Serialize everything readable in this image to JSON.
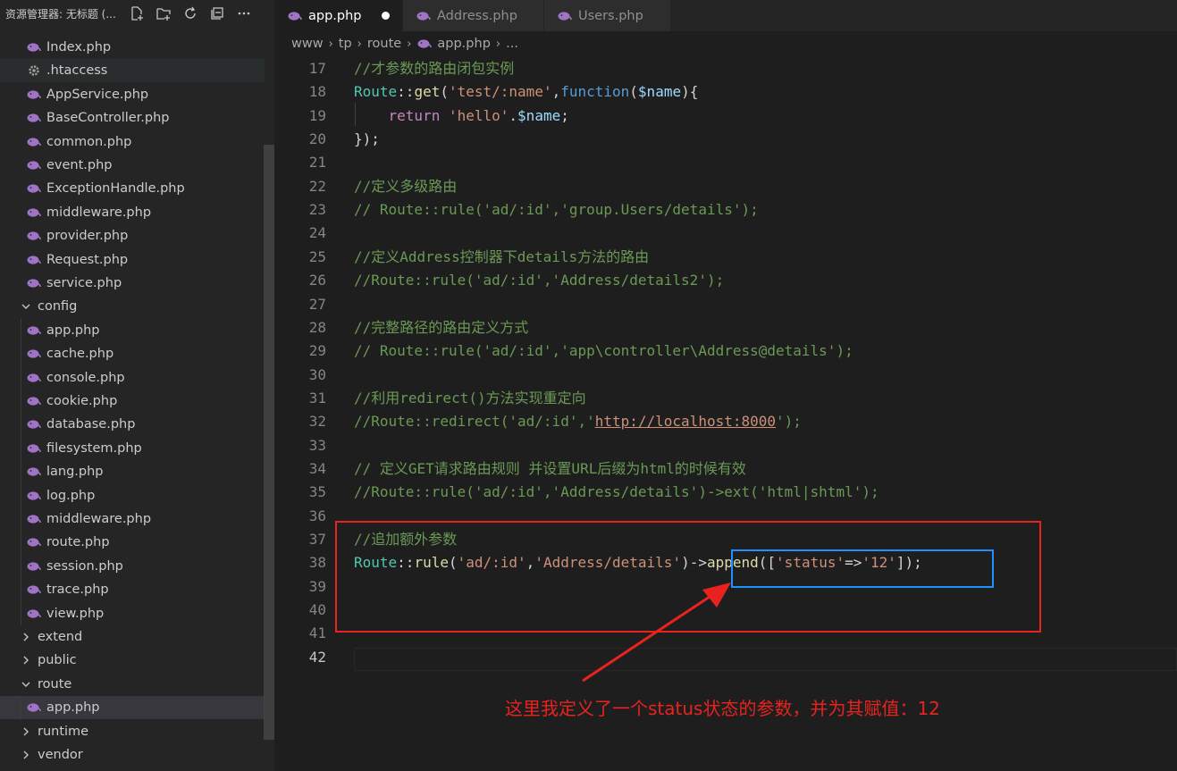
{
  "sidebar": {
    "title": "资源管理器: 无标题 (...",
    "tree": [
      {
        "label": "Index.php",
        "kind": "php"
      },
      {
        "label": ".htaccess",
        "kind": "gear"
      },
      {
        "label": "AppService.php",
        "kind": "php"
      },
      {
        "label": "BaseController.php",
        "kind": "php"
      },
      {
        "label": "common.php",
        "kind": "php"
      },
      {
        "label": "event.php",
        "kind": "php"
      },
      {
        "label": "ExceptionHandle.php",
        "kind": "php"
      },
      {
        "label": "middleware.php",
        "kind": "php"
      },
      {
        "label": "provider.php",
        "kind": "php"
      },
      {
        "label": "Request.php",
        "kind": "php"
      },
      {
        "label": "service.php",
        "kind": "php"
      },
      {
        "label": "config",
        "kind": "folder-open"
      },
      {
        "label": "app.php",
        "kind": "php"
      },
      {
        "label": "cache.php",
        "kind": "php"
      },
      {
        "label": "console.php",
        "kind": "php"
      },
      {
        "label": "cookie.php",
        "kind": "php"
      },
      {
        "label": "database.php",
        "kind": "php"
      },
      {
        "label": "filesystem.php",
        "kind": "php"
      },
      {
        "label": "lang.php",
        "kind": "php"
      },
      {
        "label": "log.php",
        "kind": "php"
      },
      {
        "label": "middleware.php",
        "kind": "php"
      },
      {
        "label": "route.php",
        "kind": "php"
      },
      {
        "label": "session.php",
        "kind": "php"
      },
      {
        "label": "trace.php",
        "kind": "php"
      },
      {
        "label": "view.php",
        "kind": "php"
      },
      {
        "label": "extend",
        "kind": "folder-closed"
      },
      {
        "label": "public",
        "kind": "folder-closed"
      },
      {
        "label": "route",
        "kind": "folder-open"
      },
      {
        "label": "app.php",
        "kind": "php"
      },
      {
        "label": "runtime",
        "kind": "folder-closed"
      },
      {
        "label": "vendor",
        "kind": "folder-closed"
      }
    ]
  },
  "tabs": [
    {
      "label": "app.php",
      "active": true,
      "dirty": true
    },
    {
      "label": "Address.php",
      "active": false,
      "dirty": false
    },
    {
      "label": "Users.php",
      "active": false,
      "dirty": false
    }
  ],
  "breadcrumb": [
    "www",
    "tp",
    "route",
    "app.php",
    "..."
  ],
  "editor": {
    "active_line": "42",
    "lines": [
      {
        "n": "17",
        "tokens": [
          [
            "c-cmt",
            "//才参数的路由闭包实例"
          ]
        ]
      },
      {
        "n": "18",
        "tokens": [
          [
            "c-cls",
            "Route"
          ],
          [
            "",
            "::"
          ],
          [
            "c-fn",
            "get"
          ],
          [
            "",
            "("
          ],
          [
            "c-str",
            "'test/:name'"
          ],
          [
            "",
            ","
          ],
          [
            "c-sto",
            "function"
          ],
          [
            "",
            "("
          ],
          [
            "c-var",
            "$name"
          ],
          [
            "",
            "){"
          ]
        ]
      },
      {
        "n": "19",
        "tokens": [
          [
            "",
            "    "
          ],
          [
            "c-kw",
            "return"
          ],
          [
            "",
            " "
          ],
          [
            "c-str",
            "'hello'"
          ],
          [
            "",
            "."
          ],
          [
            "c-var",
            "$name"
          ],
          [
            "",
            ";"
          ]
        ]
      },
      {
        "n": "20",
        "tokens": [
          [
            "",
            "});"
          ]
        ]
      },
      {
        "n": "21",
        "tokens": []
      },
      {
        "n": "22",
        "tokens": [
          [
            "c-cmt",
            "//定义多级路由"
          ]
        ]
      },
      {
        "n": "23",
        "tokens": [
          [
            "c-cmt",
            "// Route::rule('ad/:id','group.Users/details');"
          ]
        ]
      },
      {
        "n": "24",
        "tokens": []
      },
      {
        "n": "25",
        "tokens": [
          [
            "c-cmt",
            "//定义Address控制器下details方法的路由"
          ]
        ]
      },
      {
        "n": "26",
        "tokens": [
          [
            "c-cmt",
            "//Route::rule('ad/:id','Address/details2');"
          ]
        ]
      },
      {
        "n": "27",
        "tokens": []
      },
      {
        "n": "28",
        "tokens": [
          [
            "c-cmt",
            "//完整路径的路由定义方式"
          ]
        ]
      },
      {
        "n": "29",
        "tokens": [
          [
            "c-cmt",
            "// Route::rule('ad/:id','app\\controller\\Address@details');"
          ]
        ]
      },
      {
        "n": "30",
        "tokens": []
      },
      {
        "n": "31",
        "tokens": [
          [
            "c-cmt",
            "//利用redirect()方法实现重定向"
          ]
        ]
      },
      {
        "n": "32",
        "tokens": [
          [
            "c-cmt",
            "//Route::redirect('ad/:id','"
          ],
          [
            "c-url",
            "http://localhost:8000"
          ],
          [
            "c-cmt",
            "');"
          ]
        ]
      },
      {
        "n": "33",
        "tokens": []
      },
      {
        "n": "34",
        "tokens": [
          [
            "c-cmt",
            "// 定义GET请求路由规则 并设置URL后缀为html的时候有效"
          ]
        ]
      },
      {
        "n": "35",
        "tokens": [
          [
            "c-cmt",
            "//Route::rule('ad/:id','Address/details')->ext('html|shtml');"
          ]
        ]
      },
      {
        "n": "36",
        "tokens": []
      },
      {
        "n": "37",
        "tokens": [
          [
            "c-cmt",
            "//追加额外参数"
          ]
        ]
      },
      {
        "n": "38",
        "tokens": [
          [
            "c-cls",
            "Route"
          ],
          [
            "",
            "::"
          ],
          [
            "c-fn",
            "rule"
          ],
          [
            "",
            "("
          ],
          [
            "c-str",
            "'ad/:id'"
          ],
          [
            "",
            ","
          ],
          [
            "c-str",
            "'Address/details'"
          ],
          [
            "",
            ")->"
          ],
          [
            "c-fn",
            "append"
          ],
          [
            "",
            "(["
          ],
          [
            "c-str",
            "'status'"
          ],
          [
            "",
            "=>"
          ],
          [
            "c-str",
            "'12'"
          ],
          [
            "",
            "]);"
          ]
        ]
      },
      {
        "n": "39",
        "tokens": []
      },
      {
        "n": "40",
        "tokens": []
      },
      {
        "n": "41",
        "tokens": []
      },
      {
        "n": "42",
        "tokens": []
      }
    ]
  },
  "annotation": "这里我定义了一个status状态的参数，并为其赋值：12",
  "colors": {
    "highlight_box": "#e8231f",
    "selection_box": "#1e90ff",
    "php_icon": "#a074c4"
  }
}
